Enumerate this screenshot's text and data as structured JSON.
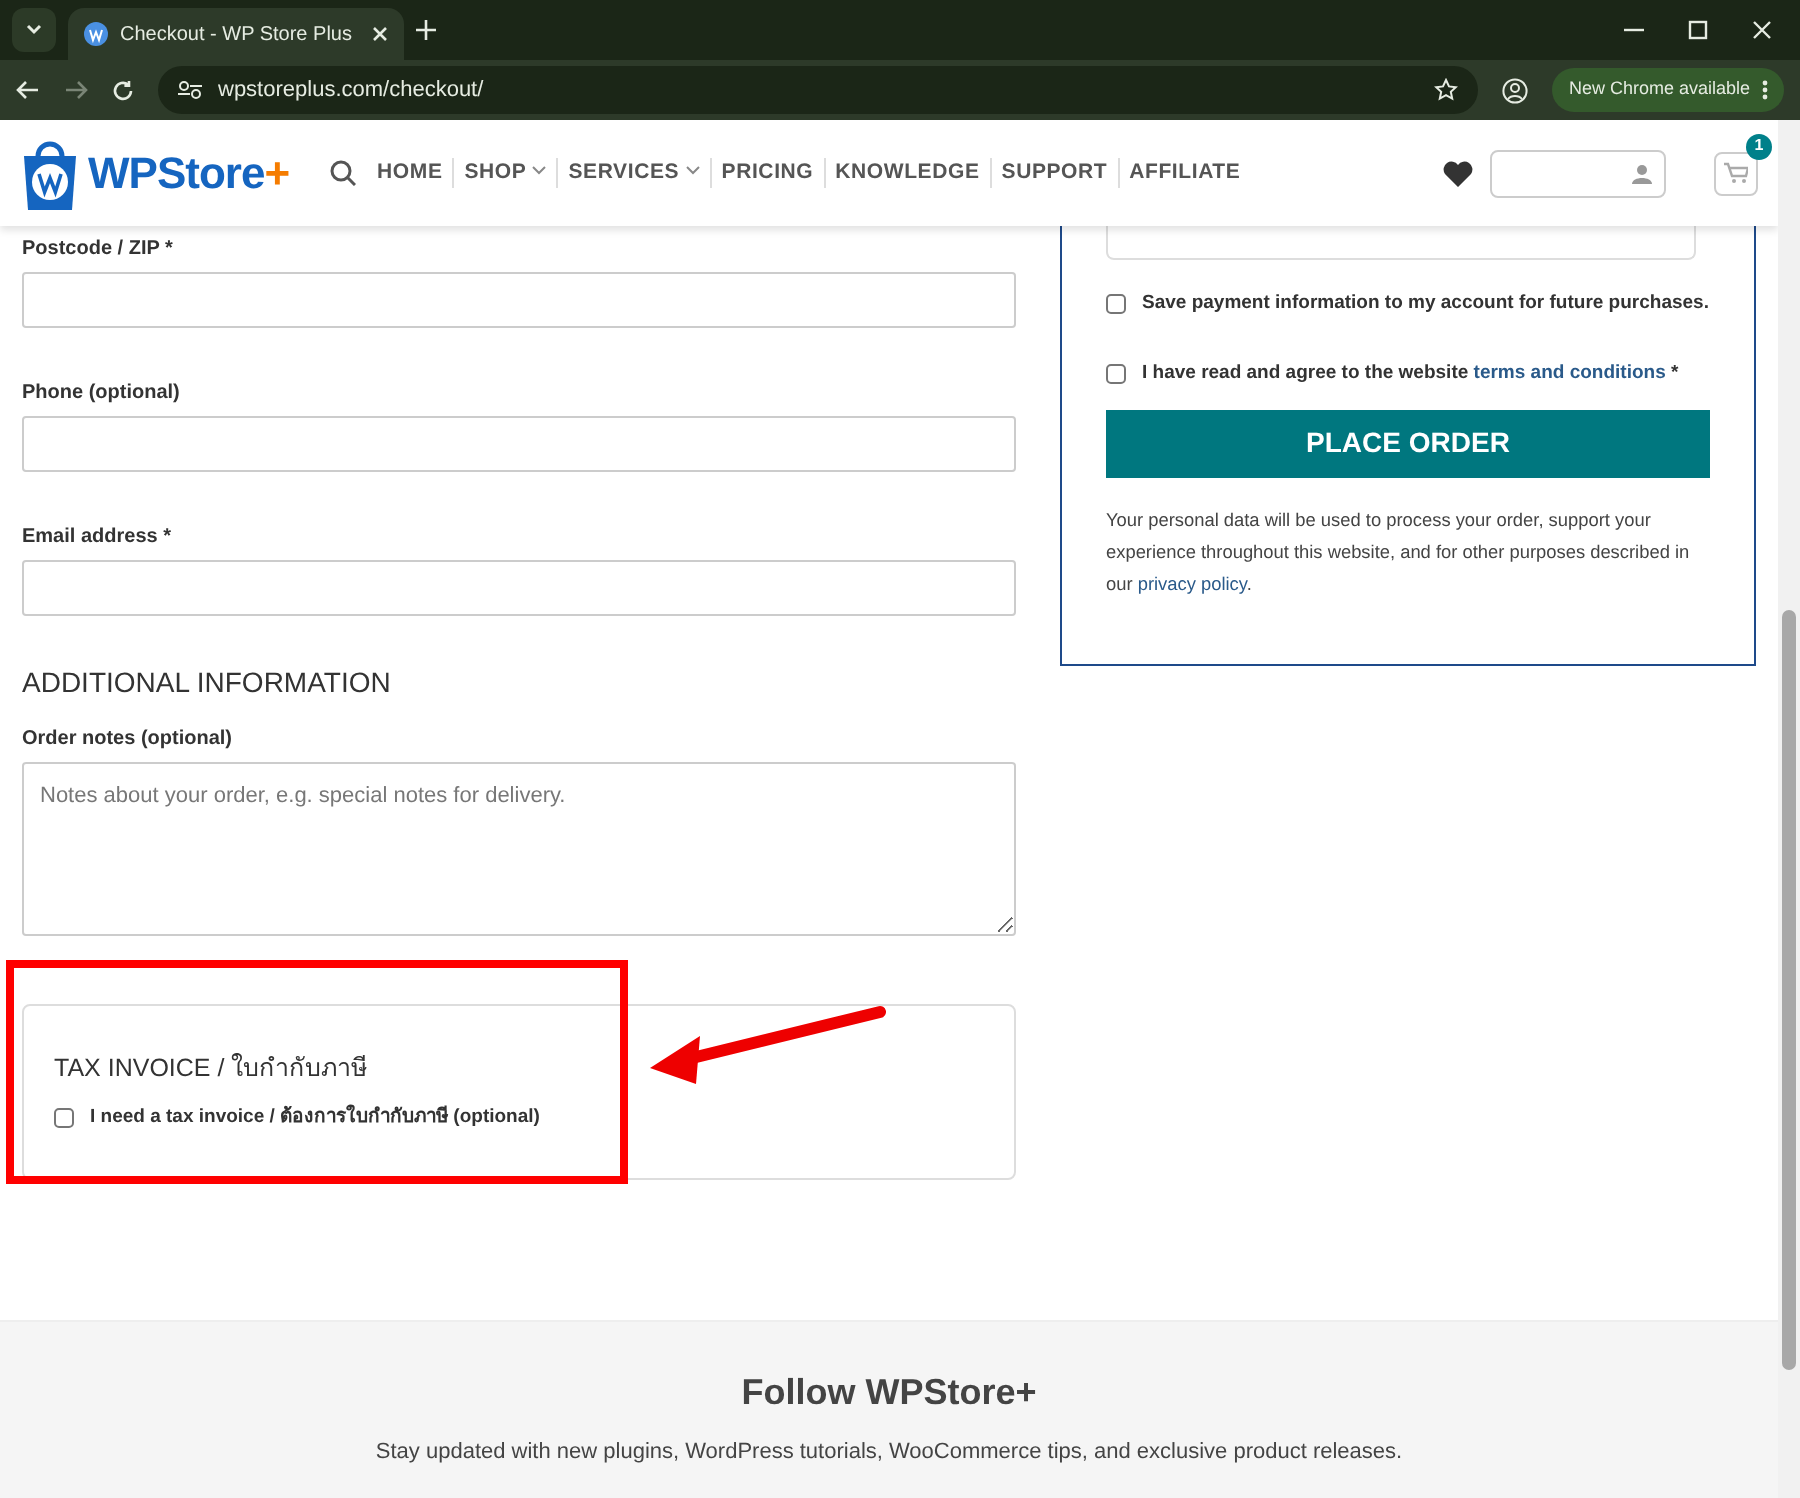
{
  "browser": {
    "tab_title": "Checkout - WP Store Plus",
    "url": "wpstoreplus.com/checkout/",
    "update_label": "New Chrome available"
  },
  "header": {
    "logo_text": "WPStore+",
    "nav": [
      {
        "label": "HOME",
        "dropdown": false
      },
      {
        "label": "SHOP",
        "dropdown": true
      },
      {
        "label": "SERVICES",
        "dropdown": true
      },
      {
        "label": "PRICING",
        "dropdown": false
      },
      {
        "label": "KNOWLEDGE",
        "dropdown": false
      },
      {
        "label": "SUPPORT",
        "dropdown": false
      },
      {
        "label": "AFFILIATE",
        "dropdown": false
      }
    ],
    "cart_count": "1"
  },
  "billing_fields": [
    {
      "label": "Postcode / ZIP *"
    },
    {
      "label": "Phone (optional)"
    },
    {
      "label": "Email address *"
    }
  ],
  "additional": {
    "heading": "ADDITIONAL INFORMATION",
    "notes_label": "Order notes (optional)",
    "notes_placeholder": "Notes about your order, e.g. special notes for delivery."
  },
  "tax_invoice": {
    "heading": "TAX INVOICE / ใบกำกับภาษี",
    "checkbox_label": "I need a tax invoice / ต้องการใบกำกับภาษี (optional)",
    "checked": false
  },
  "order": {
    "save_payment": {
      "label": "Save payment information to my account for future purchases.",
      "checked": false
    },
    "terms": {
      "before": "I have read and agree to the website ",
      "link": "terms and conditions",
      "after": " *",
      "checked": false
    },
    "button": "PLACE ORDER",
    "privacy": {
      "before": "Your personal data will be used to process your order, support your experience throughout this website, and for other purposes described in our ",
      "link": "privacy policy",
      "after": "."
    }
  },
  "footer": {
    "title": "Follow WPStore+",
    "text": "Stay updated with new plugins, WordPress tutorials, WooCommerce tips, and exclusive product releases."
  }
}
